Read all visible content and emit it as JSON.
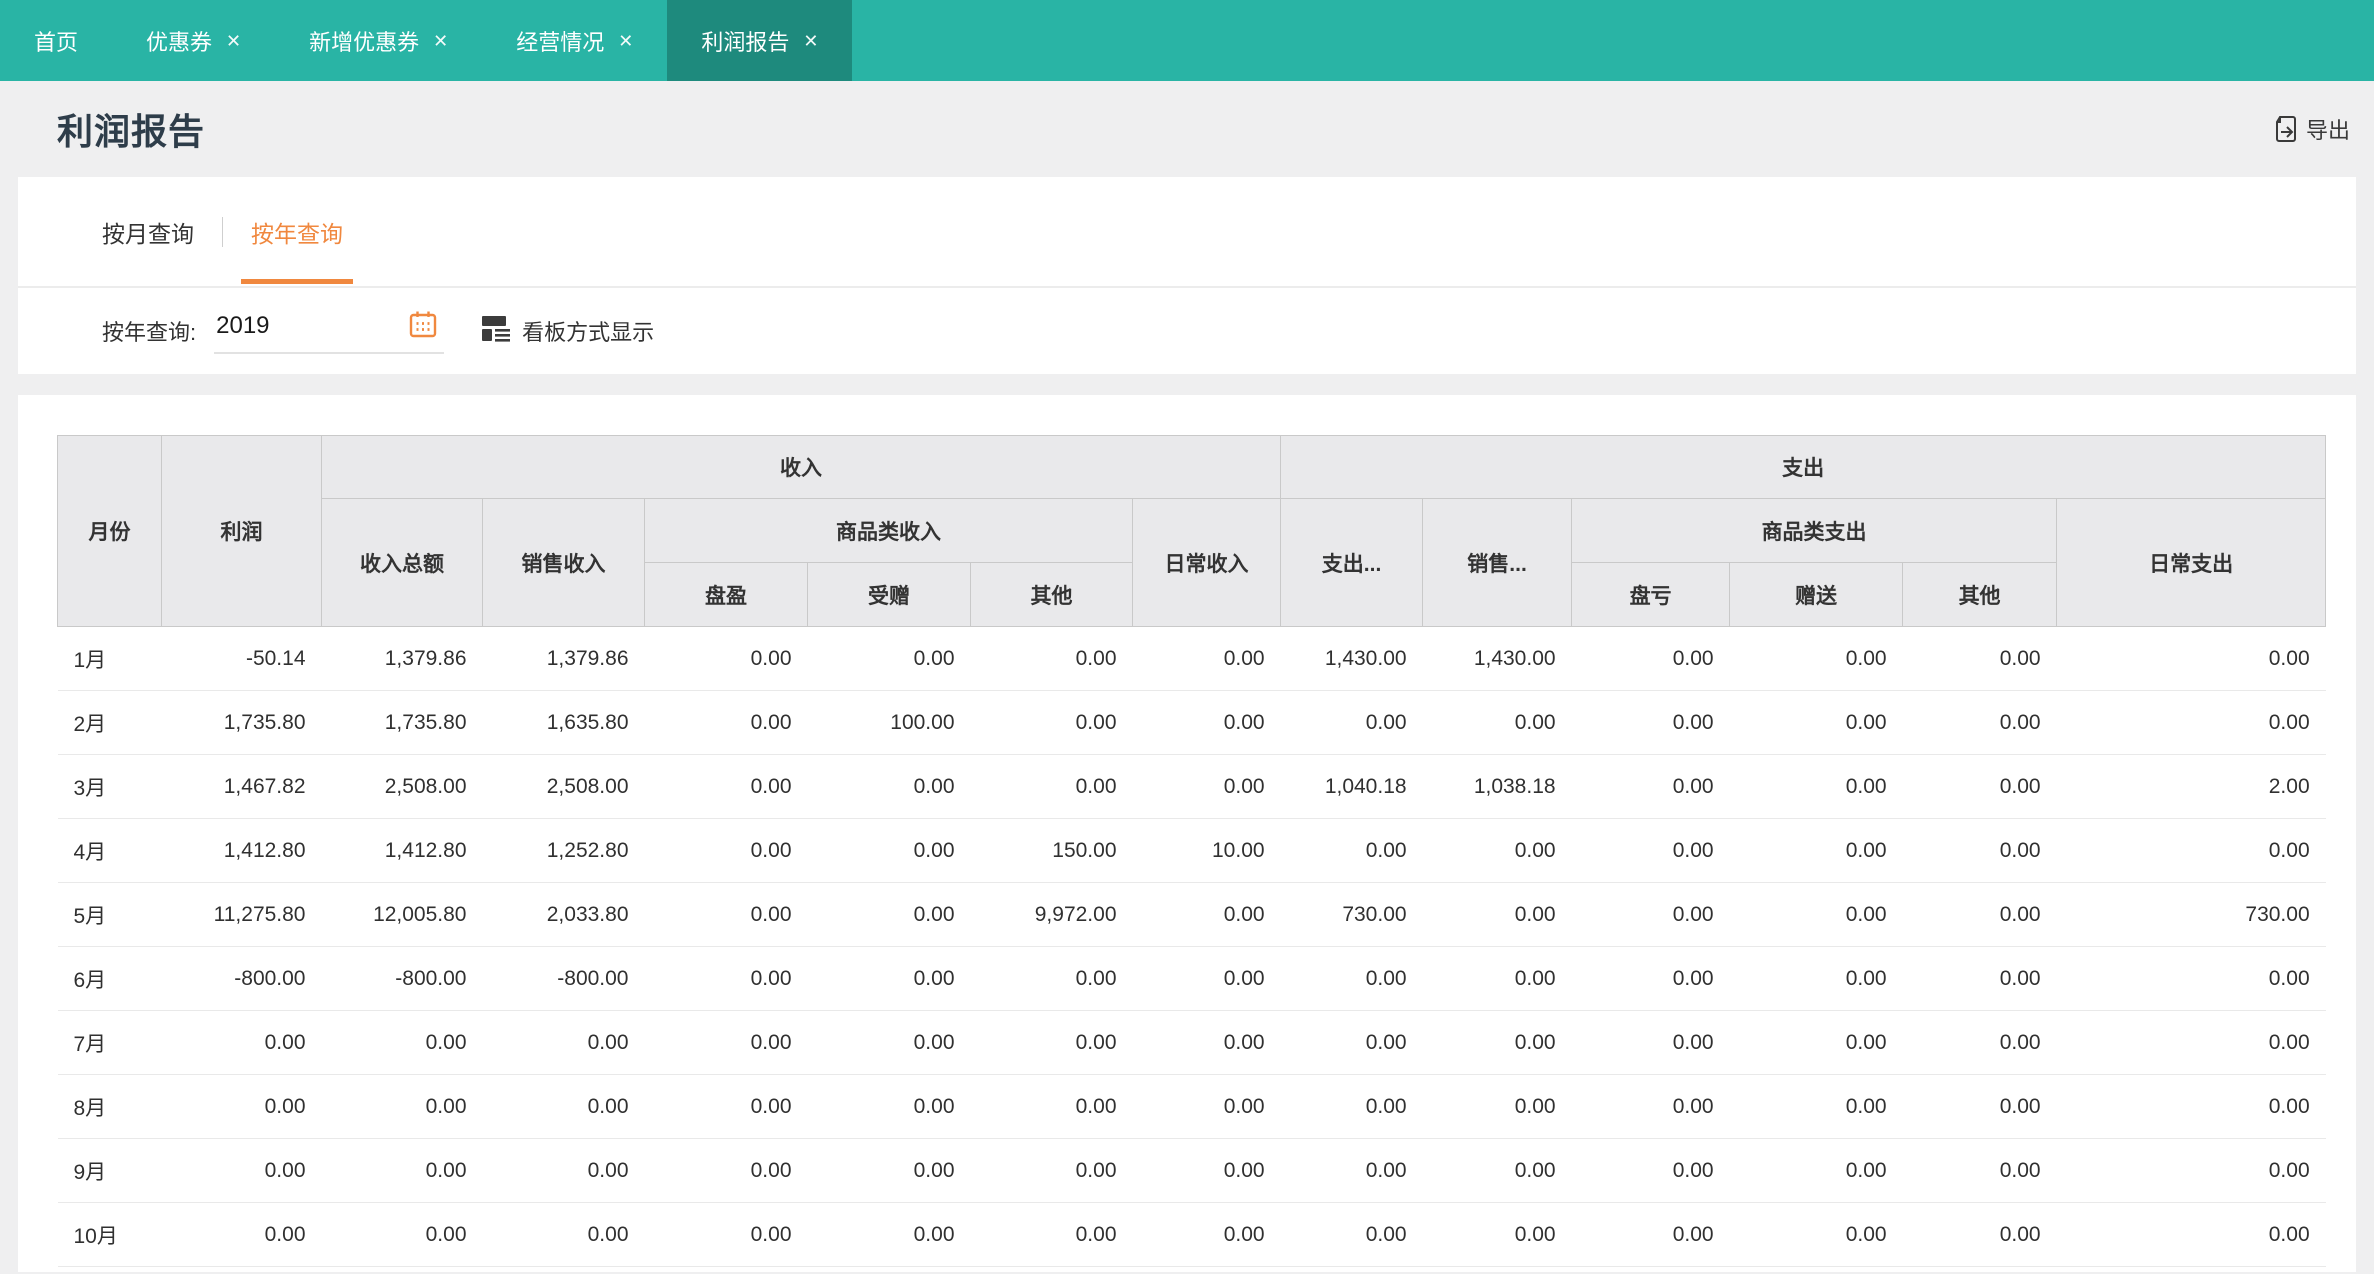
{
  "topbar": {
    "tabs": [
      {
        "label": "首页",
        "closable": false,
        "active": false
      },
      {
        "label": "优惠券",
        "closable": true,
        "active": false
      },
      {
        "label": "新增优惠券",
        "closable": true,
        "active": false
      },
      {
        "label": "经营情况",
        "closable": true,
        "active": false
      },
      {
        "label": "利润报告",
        "closable": true,
        "active": true
      }
    ]
  },
  "icons": {
    "close": "✕"
  },
  "page": {
    "title": "利润报告",
    "export_label": "导出"
  },
  "view_tabs": {
    "monthly": "按月查询",
    "yearly": "按年查询"
  },
  "filter": {
    "label": "按年查询:",
    "year": "2019",
    "board_label": "看板方式显示"
  },
  "table": {
    "headers": {
      "month": "月份",
      "profit": "利润",
      "income_group": "收入",
      "expense_group": "支出",
      "income_total": "收入总额",
      "income_sales": "销售收入",
      "income_goods_group": "商品类收入",
      "income_surplus": "盘盈",
      "income_gift": "受赠",
      "income_other": "其他",
      "income_daily": "日常收入",
      "expense_total": "支出...",
      "expense_sales": "销售...",
      "expense_goods_group": "商品类支出",
      "expense_loss": "盘亏",
      "expense_give": "赠送",
      "expense_other": "其他",
      "expense_daily": "日常支出"
    },
    "rows": [
      [
        "1月",
        "-50.14",
        "1,379.86",
        "1,379.86",
        "0.00",
        "0.00",
        "0.00",
        "0.00",
        "1,430.00",
        "1,430.00",
        "0.00",
        "0.00",
        "0.00",
        "0.00"
      ],
      [
        "2月",
        "1,735.80",
        "1,735.80",
        "1,635.80",
        "0.00",
        "100.00",
        "0.00",
        "0.00",
        "0.00",
        "0.00",
        "0.00",
        "0.00",
        "0.00",
        "0.00"
      ],
      [
        "3月",
        "1,467.82",
        "2,508.00",
        "2,508.00",
        "0.00",
        "0.00",
        "0.00",
        "0.00",
        "1,040.18",
        "1,038.18",
        "0.00",
        "0.00",
        "0.00",
        "2.00"
      ],
      [
        "4月",
        "1,412.80",
        "1,412.80",
        "1,252.80",
        "0.00",
        "0.00",
        "150.00",
        "10.00",
        "0.00",
        "0.00",
        "0.00",
        "0.00",
        "0.00",
        "0.00"
      ],
      [
        "5月",
        "11,275.80",
        "12,005.80",
        "2,033.80",
        "0.00",
        "0.00",
        "9,972.00",
        "0.00",
        "730.00",
        "0.00",
        "0.00",
        "0.00",
        "0.00",
        "730.00"
      ],
      [
        "6月",
        "-800.00",
        "-800.00",
        "-800.00",
        "0.00",
        "0.00",
        "0.00",
        "0.00",
        "0.00",
        "0.00",
        "0.00",
        "0.00",
        "0.00",
        "0.00"
      ],
      [
        "7月",
        "0.00",
        "0.00",
        "0.00",
        "0.00",
        "0.00",
        "0.00",
        "0.00",
        "0.00",
        "0.00",
        "0.00",
        "0.00",
        "0.00",
        "0.00"
      ],
      [
        "8月",
        "0.00",
        "0.00",
        "0.00",
        "0.00",
        "0.00",
        "0.00",
        "0.00",
        "0.00",
        "0.00",
        "0.00",
        "0.00",
        "0.00",
        "0.00"
      ],
      [
        "9月",
        "0.00",
        "0.00",
        "0.00",
        "0.00",
        "0.00",
        "0.00",
        "0.00",
        "0.00",
        "0.00",
        "0.00",
        "0.00",
        "0.00",
        "0.00"
      ],
      [
        "10月",
        "0.00",
        "0.00",
        "0.00",
        "0.00",
        "0.00",
        "0.00",
        "0.00",
        "0.00",
        "0.00",
        "0.00",
        "0.00",
        "0.00",
        "0.00"
      ]
    ]
  },
  "colors": {
    "brand_teal": "#29b4a5",
    "brand_teal_dark": "#1e8a7d",
    "accent_orange": "#f0883f",
    "header_bg": "#e9e9eb",
    "page_bg": "#efeff0"
  }
}
